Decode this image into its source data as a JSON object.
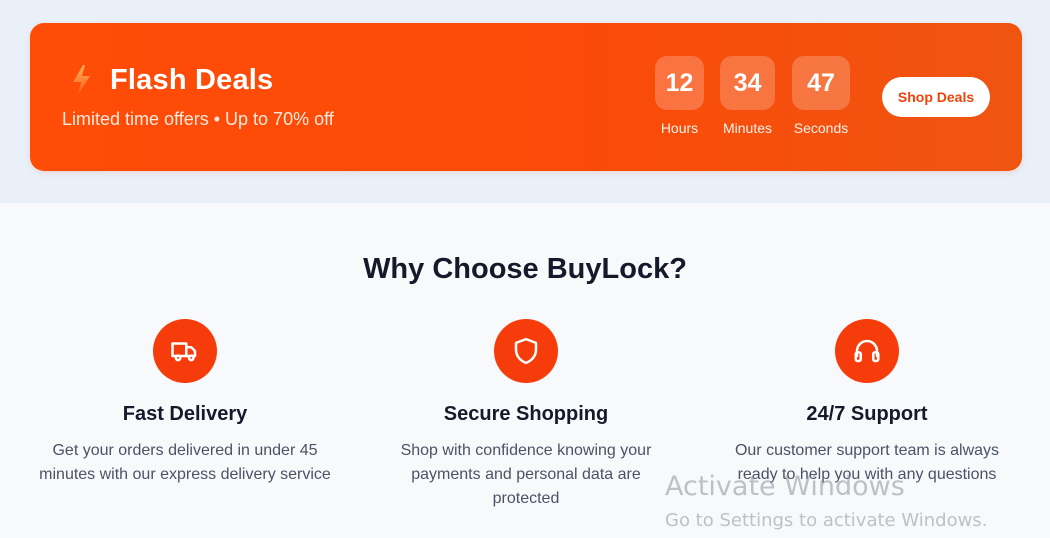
{
  "flash": {
    "title": "Flash Deals",
    "subtitle": "Limited time offers • Up to 70% off",
    "icon": "lightning-bolt-icon",
    "countdown": [
      {
        "value": "12",
        "label": "Hours"
      },
      {
        "value": "34",
        "label": "Minutes"
      },
      {
        "value": "47",
        "label": "Seconds"
      }
    ],
    "button_label": "Shop Deals"
  },
  "why": {
    "title": "Why Choose BuyLock?",
    "features": [
      {
        "icon": "truck-icon",
        "title": "Fast Delivery",
        "description": "Get your orders delivered in under 45 minutes with our express delivery service"
      },
      {
        "icon": "shield-icon",
        "title": "Secure Shopping",
        "description": "Shop with confidence knowing your payments and personal data are protected"
      },
      {
        "icon": "headphones-icon",
        "title": "24/7 Support",
        "description": "Our customer support team is always ready to help you with any questions"
      }
    ]
  },
  "watermark": {
    "title": "Activate Windows",
    "subtitle": "Go to Settings to activate Windows."
  },
  "colors": {
    "accent": "#f63c0b",
    "banner_start": "#ff4d07",
    "banner_end": "#ef5511",
    "heading": "#141a2a",
    "body_text": "#4a5366"
  }
}
